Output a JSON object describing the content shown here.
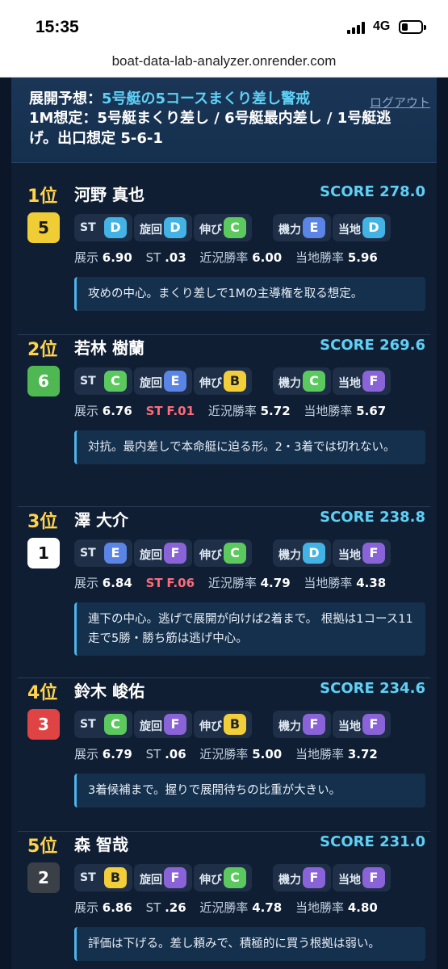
{
  "status": {
    "time": "15:35",
    "network": "4G",
    "battery": 0.3
  },
  "url": "boat-data-lab-analyzer.onrender.com",
  "summary": {
    "prefix": "展開予想：",
    "headline": "5号艇の5コースまくり差し警戒",
    "detail": "1M想定：5号艇まくり差し / 6号艇最内差し / 1号艇逃げ。出口想定 5-6-1",
    "logout": "ログアウト"
  },
  "labels": {
    "st": "ST",
    "turn": "旋回",
    "nobi": "伸び",
    "power": "機力",
    "local": "当地",
    "tenji": "展示",
    "kinkyo": "近況勝率",
    "touchi": "当地勝率",
    "score_prefix": "SCORE"
  },
  "colors": {
    "score": "#5fd0f5",
    "rank": "#ffd24a",
    "warn": "#ff6b7a"
  },
  "racers": [
    {
      "rank": "1位",
      "name": "河野 真也",
      "score": "278.0",
      "boat": "5",
      "boat_bg": "#f0cc35",
      "boat_fg": "#1a1a1a",
      "grades": [
        "D",
        "D",
        "C",
        "E",
        "D"
      ],
      "tenji": "6.90",
      "st": ".03",
      "st_flag": false,
      "kinkyo": "6.00",
      "touchi": "5.96",
      "comment": "攻めの中心。まくり差しで1Mの主導権を取る想定。"
    },
    {
      "rank": "2位",
      "name": "若林 樹蘭",
      "score": "269.6",
      "boat": "6",
      "boat_bg": "#4fb852",
      "boat_fg": "#ffffff",
      "grades": [
        "C",
        "E",
        "B",
        "C",
        "F"
      ],
      "tenji": "6.76",
      "st": "F.01",
      "st_flag": true,
      "kinkyo": "5.72",
      "touchi": "5.67",
      "comment": "対抗。最内差しで本命艇に迫る形。2・3着では切れない。"
    },
    {
      "rank": "3位",
      "name": "澤 大介",
      "score": "238.8",
      "boat": "1",
      "boat_bg": "#ffffff",
      "boat_fg": "#111111",
      "grades": [
        "E",
        "F",
        "C",
        "D",
        "F"
      ],
      "tenji": "6.84",
      "st": "F.06",
      "st_flag": true,
      "kinkyo": "4.79",
      "touchi": "4.38",
      "comment": "連下の中心。逃げで展開が向けば2着まで。 根拠は1コース11走で5勝・勝ち筋は逃げ中心。"
    },
    {
      "rank": "4位",
      "name": "鈴木 峻佑",
      "score": "234.6",
      "boat": "3",
      "boat_bg": "#e04343",
      "boat_fg": "#ffffff",
      "grades": [
        "C",
        "F",
        "B",
        "F",
        "F"
      ],
      "tenji": "6.79",
      "st": ".06",
      "st_flag": false,
      "kinkyo": "5.00",
      "touchi": "3.72",
      "comment": "3着候補まで。握りで展開待ちの比重が大きい。"
    },
    {
      "rank": "5位",
      "name": "森 智哉",
      "score": "231.0",
      "boat": "2",
      "boat_bg": "#3a3f48",
      "boat_fg": "#ffffff",
      "grades": [
        "B",
        "F",
        "C",
        "F",
        "F"
      ],
      "tenji": "6.86",
      "st": ".26",
      "st_flag": false,
      "kinkyo": "4.78",
      "touchi": "4.80",
      "comment": "評価は下げる。差し頼みで、積極的に買う根拠は弱い。"
    }
  ]
}
